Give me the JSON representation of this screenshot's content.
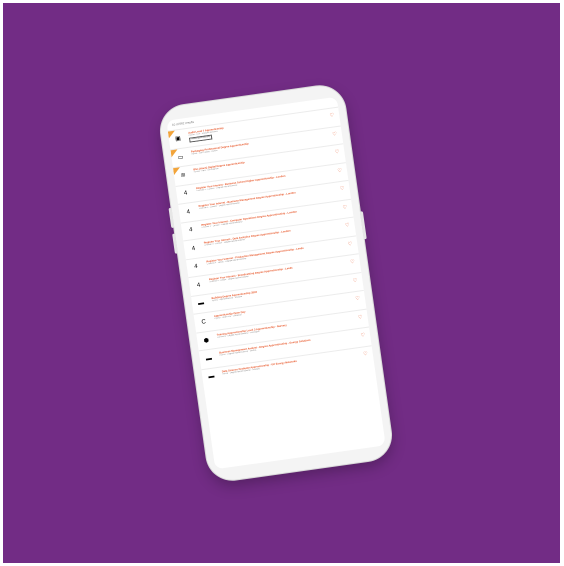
{
  "results_label": "10 of 662 results",
  "rows": [
    {
      "title": "Audit Level 7 Apprenticeship",
      "meta1": "Hybrid",
      "meta2": "Kirk",
      "meta3": "Multiple locations",
      "logo": "▣",
      "flag": true,
      "badge": "Virtual apprenticeship"
    },
    {
      "title": "Packaging Professional Degree Apprenticeship",
      "meta1": "Hybrid",
      "meta2": "Sun Closes",
      "meta3": "Burton",
      "logo": "▭",
      "flag": true,
      "badge": ""
    },
    {
      "title": "BSc (Hons) Digital Degree Apprenticeship",
      "meta1": "Hybrid",
      "meta2": "Kent",
      "meta3": "Birmingham",
      "logo": "≋",
      "flag": true,
      "badge": ""
    },
    {
      "title": "Register Your Interest - Business School Higher Apprenticeship - London",
      "meta1": "Channel 4",
      "meta2": "London",
      "meta3": "Degree Apprenticeship",
      "logo": "4",
      "flag": false,
      "badge": ""
    },
    {
      "title": "Register Your Interest - Business Management Degree Apprenticeship - London",
      "meta1": "Channel 4",
      "meta2": "London",
      "meta3": "Degree Apprenticeship",
      "logo": "4",
      "flag": false,
      "badge": ""
    },
    {
      "title": "Register Your Interest - Computer Operations Degree Apprenticeship - London",
      "meta1": "Channel 4",
      "meta2": "London",
      "meta3": "Degree Apprenticeship",
      "logo": "4",
      "flag": false,
      "badge": ""
    },
    {
      "title": "Register Your Interest - Data Analytics Degree Apprenticeship - London",
      "meta1": "Channel 4",
      "meta2": "London",
      "meta3": "Degree Apprenticeship",
      "logo": "4",
      "flag": false,
      "badge": ""
    },
    {
      "title": "Register Your Interest - Production Management Degree Apprenticeship - Leeds",
      "meta1": "Channel 4",
      "meta2": "Leeds",
      "meta3": "Degree Apprenticeship",
      "logo": "4",
      "flag": false,
      "badge": ""
    },
    {
      "title": "Register Your Interest - Broadcasting Degree Apprenticeship - Leeds",
      "meta1": "Channel 4",
      "meta2": "Leeds",
      "meta3": "Degree Apprenticeship",
      "logo": "4",
      "flag": false,
      "badge": ""
    },
    {
      "title": "Building Degree Apprenticeship 2024",
      "meta1": "Hybrid",
      "meta2": "Apprenticeship",
      "meta3": "Multiple",
      "logo": "▬",
      "flag": false,
      "badge": ""
    },
    {
      "title": "Apprenticeship Open Day",
      "meta1": "Hybrid",
      "meta2": "Open Day",
      "meta3": "Leicester",
      "logo": "C",
      "flag": false,
      "badge": ""
    },
    {
      "title": "Training Apprenticeship Level 3 Apprenticeship - Nursery",
      "meta1": "Cummins",
      "meta2": "Degree Apprenticeship",
      "meta3": "Darlington",
      "logo": "⬢",
      "flag": false,
      "badge": ""
    },
    {
      "title": "Business Management Analyst - Degree Apprenticeship - Energy Solutions",
      "meta1": "Hybrid",
      "meta2": "Degree Apprenticeship",
      "meta3": "Belfast",
      "logo": "▬",
      "flag": false,
      "badge": ""
    },
    {
      "title": "Data Science Graduate Apprenticeship - UK Energy Networks",
      "meta1": "Hybrid",
      "meta2": "Degree Apprenticeship",
      "meta3": "Multiple",
      "logo": "▬",
      "flag": false,
      "badge": ""
    }
  ],
  "colors": {
    "background": "#722c85",
    "accent": "#e8592c",
    "flag": "#f2a43a"
  },
  "icons": {
    "save": "heart-icon",
    "logo_channel4": "channel4-logo-icon"
  }
}
